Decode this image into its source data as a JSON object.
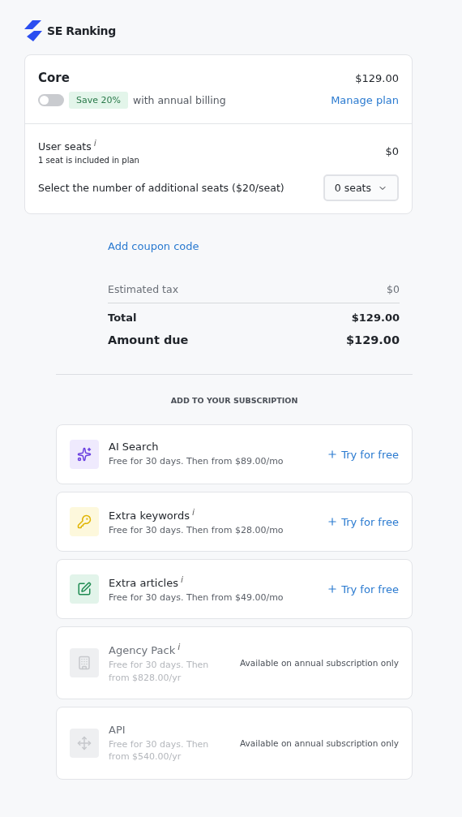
{
  "brand": {
    "name": "SE Ranking"
  },
  "plan": {
    "name": "Core",
    "price": "$129.00",
    "annual_billing": {
      "on": false
    },
    "badge": "Save 20%",
    "billing_note": "with annual billing",
    "manage_link": "Manage plan"
  },
  "seats": {
    "title": "User seats",
    "info": "i",
    "note": "1 seat is included in plan",
    "price": "$0",
    "prompt": "Select the number of additional seats ($20/seat)",
    "select_value": "0 seats"
  },
  "coupon_link": "Add coupon code",
  "summary": [
    {
      "kind": "tax",
      "label": "Estimated tax",
      "value": "$0"
    },
    {
      "kind": "total",
      "label": "Total",
      "value": "$129.00"
    },
    {
      "kind": "due",
      "label": "Amount due",
      "value": "$129.00"
    }
  ],
  "addons_heading": "ADD TO YOUR SUBSCRIPTION",
  "addons": [
    {
      "kind": "sparkles",
      "name": "AI Search",
      "description": "Free for 30 days. Then from $89.00/mo",
      "disabled": false,
      "action": "Try for free"
    },
    {
      "kind": "key",
      "name": "Extra keywords",
      "info": "i",
      "description": "Free for 30 days. Then from $28.00/mo",
      "disabled": false,
      "action": "Try for free"
    },
    {
      "kind": "edit",
      "name": "Extra articles",
      "info": "i",
      "description": "Free for 30 days. Then from $49.00/mo",
      "disabled": false,
      "action": "Try for free"
    },
    {
      "kind": "building",
      "name": "Agency Pack",
      "info": "i",
      "description": "Free for 30 days. Then from $828.00/yr",
      "disabled": true,
      "note": "Available on annual subscription only"
    },
    {
      "kind": "move",
      "name": "API",
      "description": "Free for 30 days. Then from $540.00/yr",
      "disabled": true,
      "note": "Available on annual subscription only"
    }
  ]
}
